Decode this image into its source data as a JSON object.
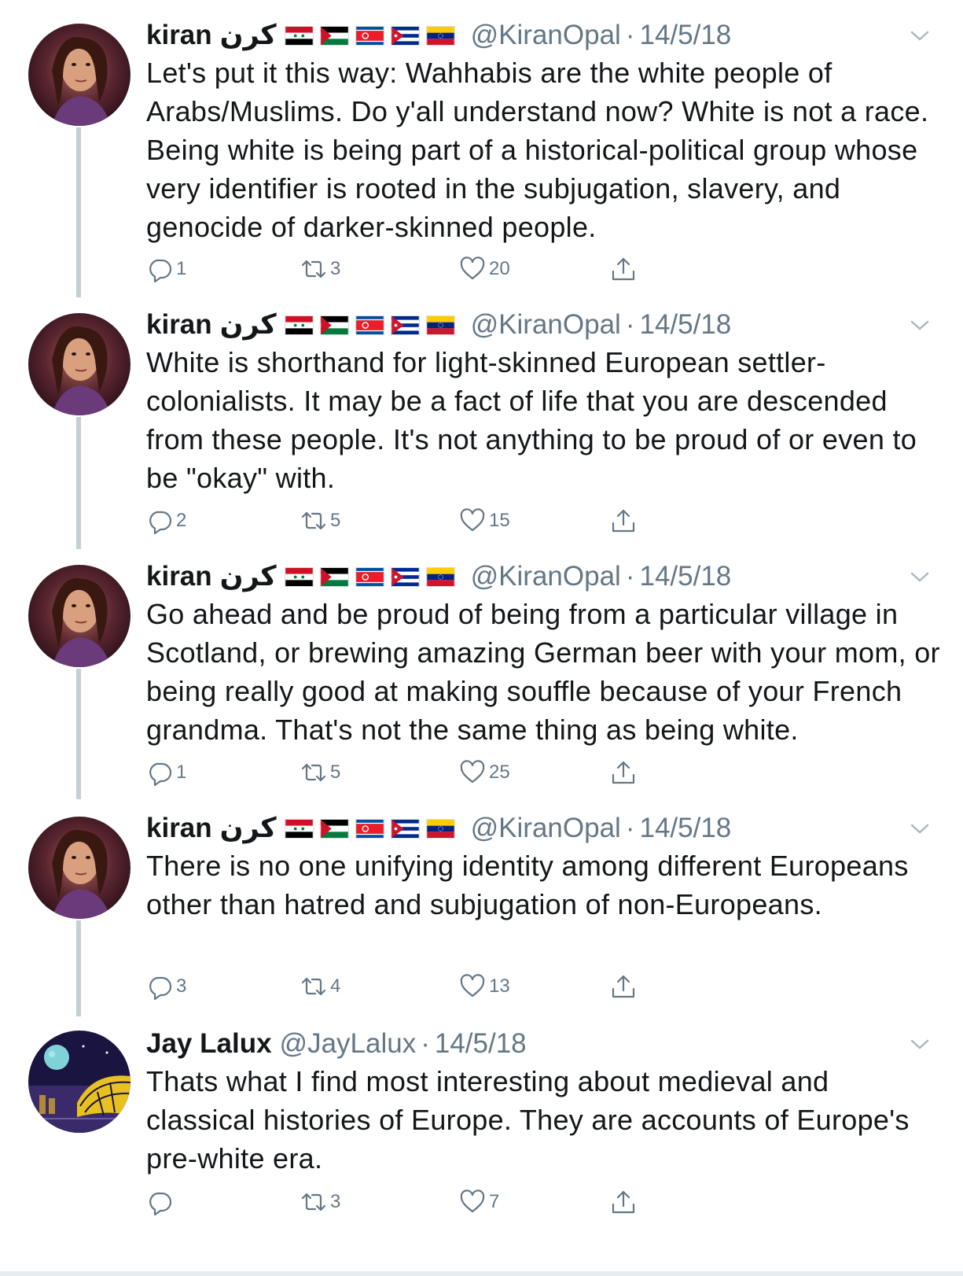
{
  "tweets": [
    {
      "name": "kiran",
      "name_arabic": "كرن",
      "handle": "@KiranOpal",
      "date": "14/5/18",
      "text": "Let's put it this way: Wahhabis are the white people of Arabs/Muslims. Do y'all understand now? White is not a race. Being white is being part of a historical-political group whose very identifier is rooted in the subjugation, slavery, and genocide of darker-skinned people.",
      "replies": "1",
      "retweets": "3",
      "likes": "20"
    },
    {
      "name": "kiran",
      "name_arabic": "كرن",
      "handle": "@KiranOpal",
      "date": "14/5/18",
      "text": "White is shorthand for light-skinned European settler-colonialists. It may be a fact of life that you are descended from these people. It's not anything to be proud of or even to be \"okay\" with.",
      "replies": "2",
      "retweets": "5",
      "likes": "15"
    },
    {
      "name": "kiran",
      "name_arabic": "كرن",
      "handle": "@KiranOpal",
      "date": "14/5/18",
      "text": "Go ahead and be proud of being from a particular village in Scotland, or brewing amazing German beer with your mom, or being really good at making souffle because of your French grandma. That's not the same thing as being white.",
      "replies": "1",
      "retweets": "5",
      "likes": "25"
    },
    {
      "name": "kiran",
      "name_arabic": "كرن",
      "handle": "@KiranOpal",
      "date": "14/5/18",
      "text": "There is no one unifying identity among different Europeans other than hatred and subjugation of non-Europeans.",
      "replies": "3",
      "retweets": "4",
      "likes": "13"
    },
    {
      "name": "Jay Lalux",
      "handle": "@JayLalux",
      "date": "14/5/18",
      "text": "Thats what I find most interesting about medieval and classical histories of Europe. They are accounts of Europe's pre-white era.",
      "replies": "",
      "retweets": "3",
      "likes": "7"
    }
  ],
  "separator": "·",
  "flags": [
    "syria-flag",
    "palestine-flag",
    "north-korea-flag",
    "cuba-flag",
    "venezuela-flag"
  ],
  "colors": {
    "text": "#14171a",
    "secondary": "#657786",
    "thread_line": "#c4cfd6"
  }
}
